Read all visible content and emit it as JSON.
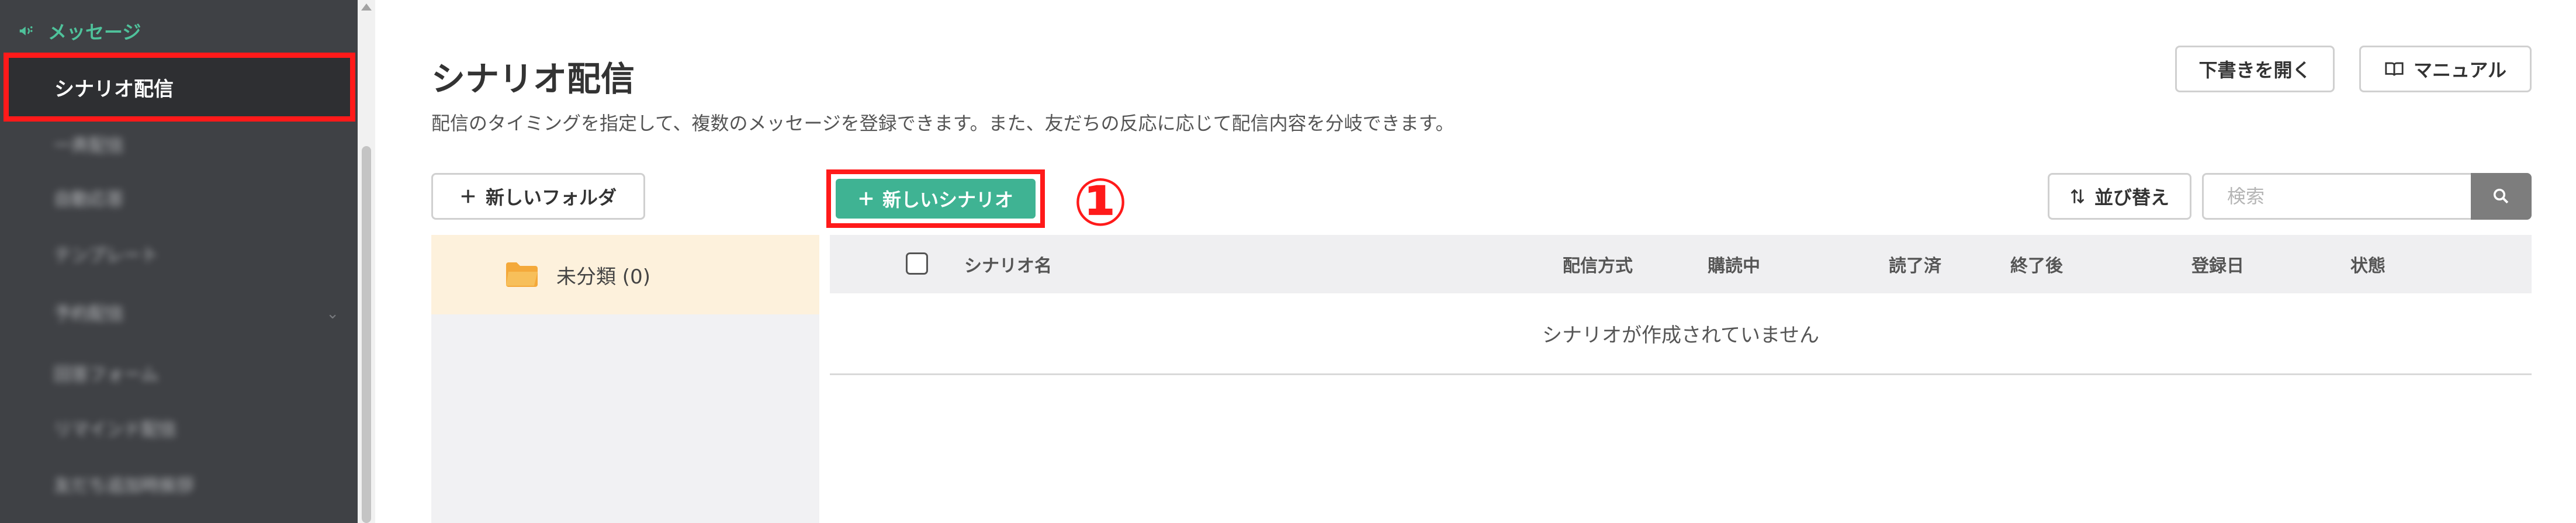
{
  "sidebar": {
    "section_label": "メッセージ",
    "active_item": "シナリオ配信",
    "blurred_items": [
      "一斉配信",
      "自動応答",
      "テンプレート",
      "予約配信",
      "回答フォーム",
      "リマインド配信",
      "友だち追加時挨拶"
    ]
  },
  "header": {
    "title": "シナリオ配信",
    "description": "配信のタイミングを指定して、複数のメッセージを登録できます。また、友だちの反応に応じて配信内容を分岐できます。",
    "draft_button": "下書きを開く",
    "manual_button": "マニュアル"
  },
  "toolbar": {
    "new_folder": "新しいフォルダ",
    "new_scenario": "新しいシナリオ",
    "step_marker": "①",
    "sort": "並び替え",
    "search_placeholder": "検索"
  },
  "folders": [
    {
      "label": "未分類 (0)"
    }
  ],
  "table": {
    "columns": [
      "シナリオ名",
      "配信方式",
      "購読中",
      "読了済",
      "終了後",
      "登録日",
      "状態"
    ],
    "empty_message": "シナリオが作成されていません"
  },
  "icons": {
    "section": "megaphone-icon",
    "plus": "plus-icon",
    "folder": "folder-icon",
    "sort": "sort-icon",
    "search": "search-icon",
    "manual": "book-icon"
  },
  "colors": {
    "sidebar_bg": "#3f4145",
    "accent_green": "#3fb393",
    "section_green": "#4fc29b",
    "highlight_red": "#ff1a1a",
    "folder_row_bg": "#fdf1dc",
    "folder_icon": "#f4a93a"
  }
}
